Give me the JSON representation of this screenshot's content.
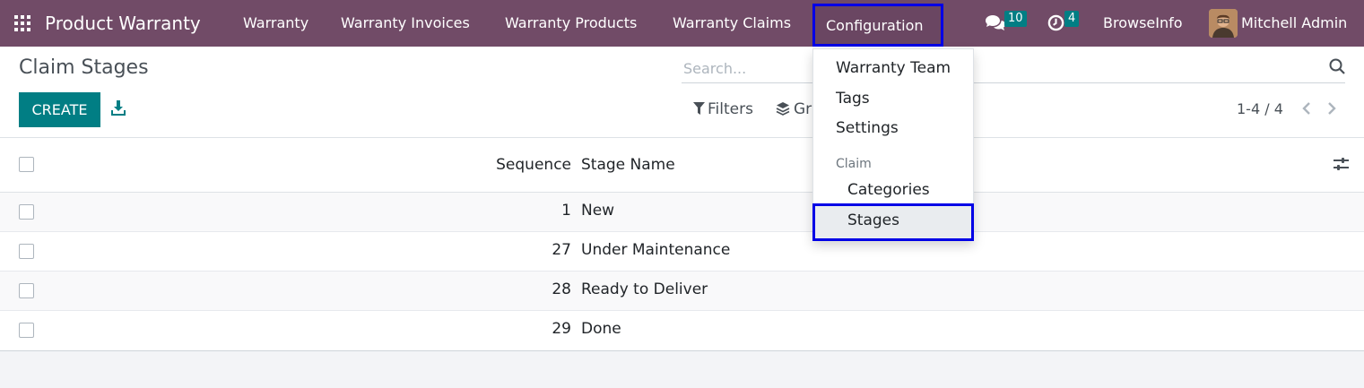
{
  "navbar": {
    "app_name": "Product Warranty",
    "menus": [
      "Warranty",
      "Warranty Invoices",
      "Warranty Products",
      "Warranty Claims",
      "Configuration"
    ],
    "messages_count": "10",
    "activities_count": "4",
    "company": "BrowseInfo",
    "user": "Mitchell Admin",
    "color": "#714b67"
  },
  "control_panel": {
    "title": "Claim Stages",
    "create_label": "CREATE",
    "search_placeholder": "Search...",
    "filters_label": "Filters",
    "groupby_label_visible": "Gr",
    "pager": "1-4 / 4"
  },
  "list": {
    "columns": [
      "Sequence",
      "Stage Name"
    ],
    "rows": [
      {
        "sequence": "1",
        "name": "New"
      },
      {
        "sequence": "27",
        "name": "Under Maintenance"
      },
      {
        "sequence": "28",
        "name": "Ready to Deliver"
      },
      {
        "sequence": "29",
        "name": "Done"
      }
    ]
  },
  "dropdown": {
    "items": [
      "Warranty Team",
      "Tags",
      "Settings"
    ],
    "section_header": "Claim",
    "section_items": [
      "Categories",
      "Stages"
    ],
    "highlight_color": "#0000e6"
  },
  "accent_color": "#017e84"
}
